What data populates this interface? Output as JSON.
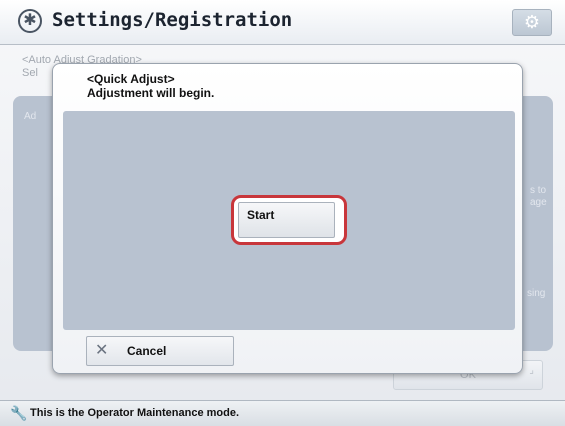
{
  "header": {
    "title": "Settings/Registration",
    "left_icon": "settings-registration-icon",
    "right_icon": "gear-icon"
  },
  "background": {
    "subtitle_line1": "<Auto Adjust Gradation>",
    "subtitle_line2": "Sel",
    "panel_fragment_left": "Ad",
    "fragment_right1": "s to",
    "fragment_right2": "age",
    "fragment_right3": "sing",
    "ok_label": "OK"
  },
  "dialog": {
    "title": "<Quick Adjust>",
    "message": "Adjustment will begin.",
    "start_label": "Start",
    "cancel_label": "Cancel",
    "cancel_icon": "close-icon"
  },
  "status_bar": {
    "text": "This is the Operator Maintenance mode.",
    "icon": "wrench-icon"
  },
  "colors": {
    "highlight": "#c8363b",
    "panel": "#b8c2d0"
  }
}
